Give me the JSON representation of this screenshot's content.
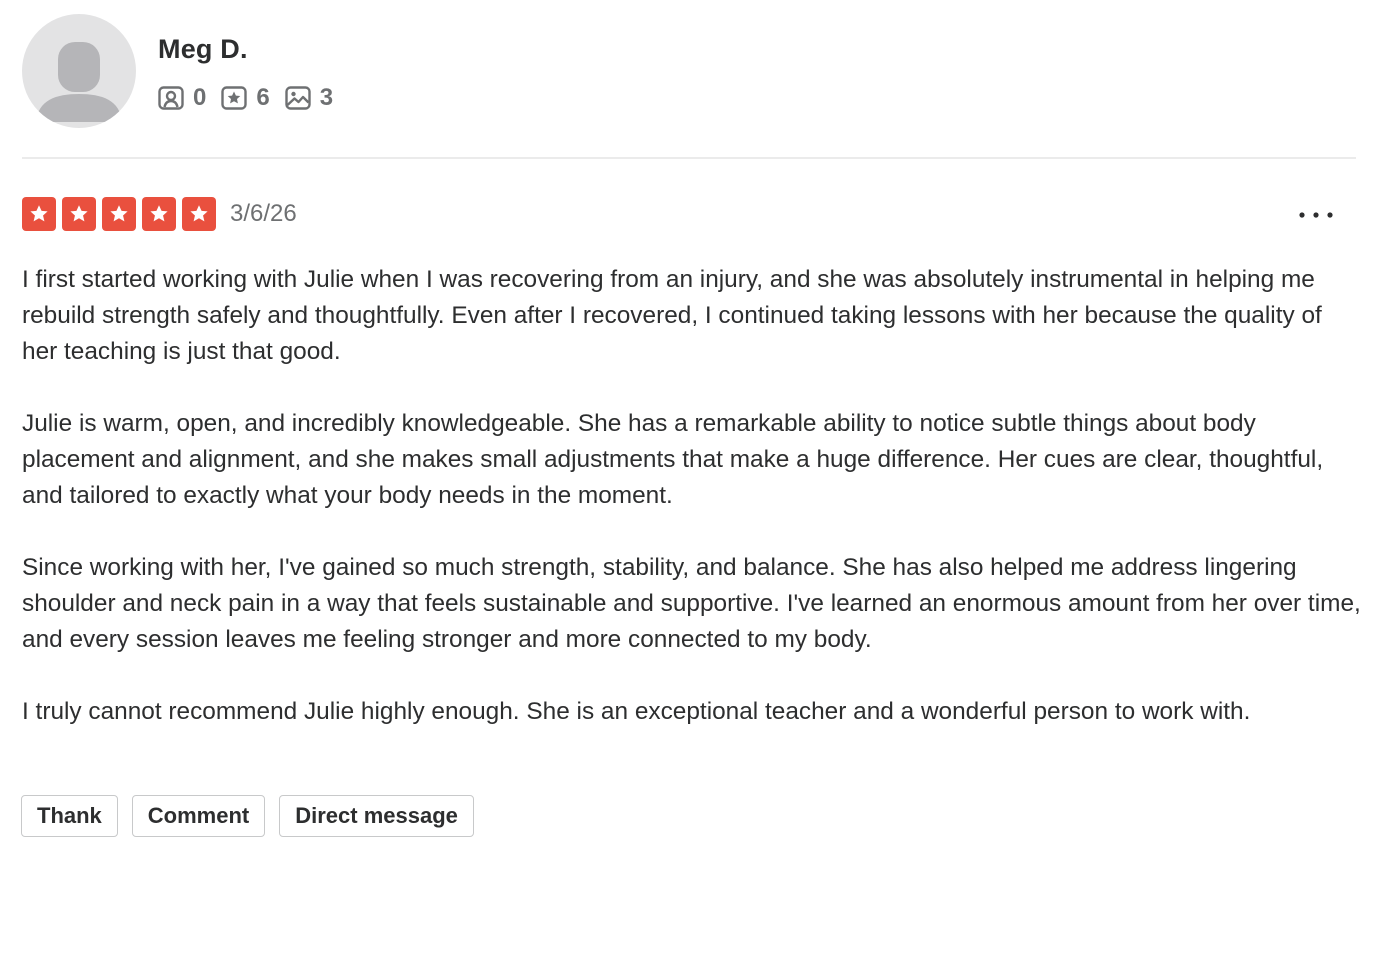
{
  "reviewer": {
    "name": "Meg D.",
    "avatar_icon": "default-user-avatar-icon",
    "stats": [
      {
        "icon": "friends-icon",
        "value": "0"
      },
      {
        "icon": "reviews-star-icon",
        "value": "6"
      },
      {
        "icon": "photos-icon",
        "value": "3"
      }
    ]
  },
  "review": {
    "rating": 5,
    "rating_max": 5,
    "rating_color": "#e9503e",
    "date": "3/6/26",
    "more_icon": "more-options-icon",
    "paragraphs": [
      "I first started working with Julie when I was recovering from an injury, and she was absolutely instrumental in helping me rebuild strength safely and thoughtfully. Even after I recovered, I continued taking lessons with her because the quality of her teaching is just that good.",
      "Julie is warm, open, and incredibly knowledgeable. She has a remarkable ability to notice subtle things about body placement and alignment, and she makes small adjustments that make a huge difference. Her cues are clear, thoughtful, and tailored to exactly what your body needs in the moment.",
      "Since working with her, I've gained so much strength, stability, and balance. She has also helped me address lingering shoulder and neck pain in a way that feels sustainable and supportive. I've learned an enormous amount from her over time, and every session leaves me feeling stronger and more connected to my body.",
      "I truly cannot recommend Julie highly enough. She is an exceptional teacher and a wonderful person to work with."
    ]
  },
  "actions": {
    "thank_label": "Thank",
    "comment_label": "Comment",
    "direct_message_label": "Direct message"
  }
}
